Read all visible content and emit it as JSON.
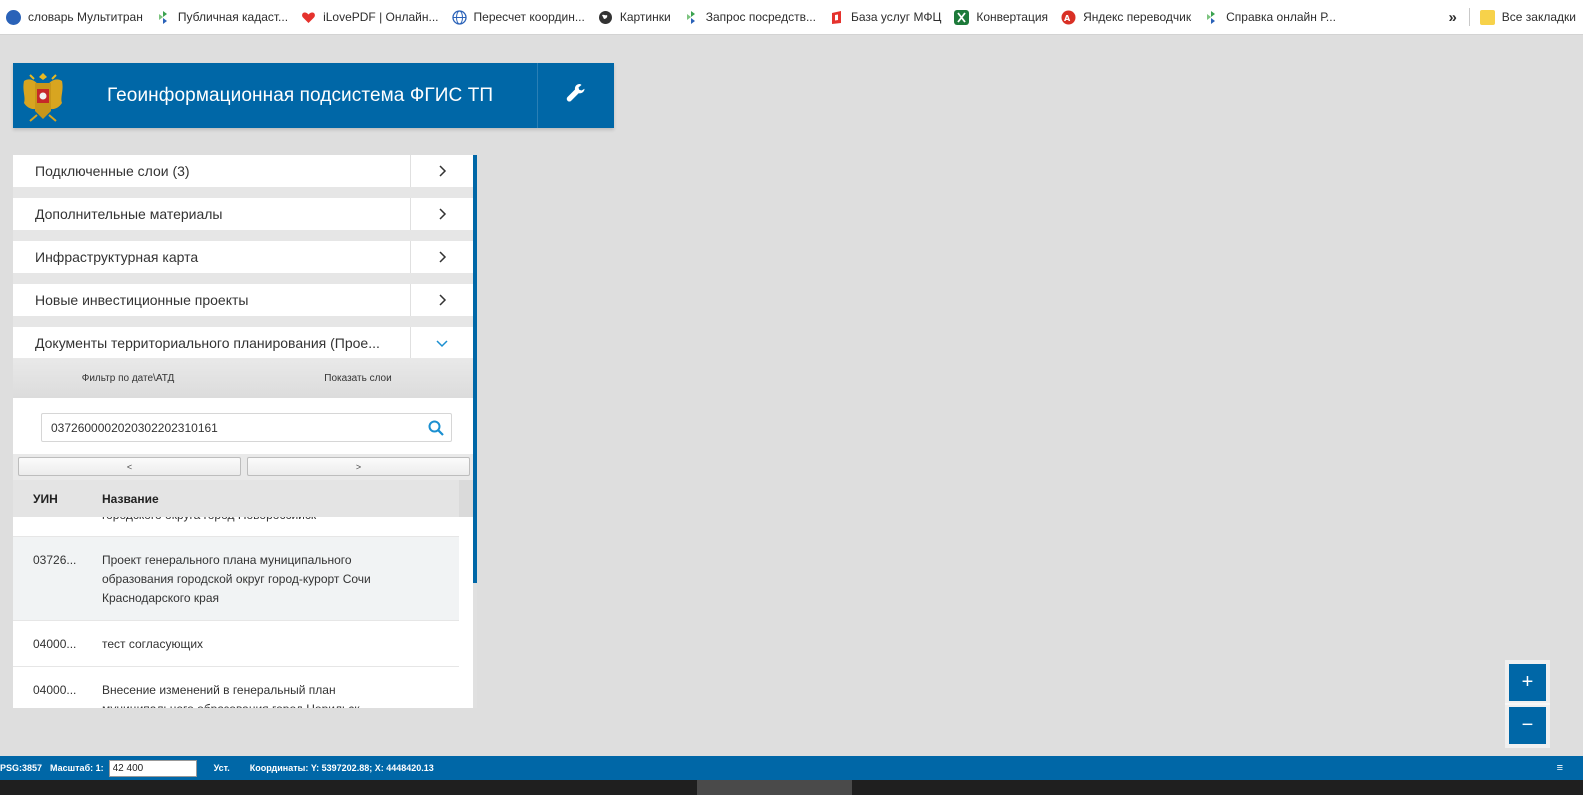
{
  "bookmarks": {
    "items": [
      {
        "label": "словарь Мультитран",
        "icon": "multitran-icon",
        "color": "#2a62b8"
      },
      {
        "label": "Публичная кадаст...",
        "icon": "rosreestr-icon",
        "color": "#3aa24f"
      },
      {
        "label": "iLovePDF | Онлайн...",
        "icon": "heart-icon",
        "color": "#e5322d"
      },
      {
        "label": "Пересчет координ...",
        "icon": "globe-icon",
        "color": "#2a62b8"
      },
      {
        "label": "Картинки",
        "icon": "globe-dark-icon",
        "color": "#333333"
      },
      {
        "label": "Запрос посредств...",
        "icon": "rosreestr-icon",
        "color": "#3aa24f"
      },
      {
        "label": "База услуг МФЦ",
        "icon": "mfc-icon",
        "color": "#e5322d"
      },
      {
        "label": "Конвертация",
        "icon": "excel-icon",
        "color": "#1d7a3a"
      },
      {
        "label": "Яндекс переводчик",
        "icon": "yandex-translate-icon",
        "color": "#d93025"
      },
      {
        "label": "Справка онлайн Р...",
        "icon": "rosreestr-icon",
        "color": "#3aa24f"
      }
    ],
    "more": "»",
    "all_label": "Все закладки"
  },
  "header": {
    "title": "Геоинформационная подсистема ФГИС ТП",
    "accent": "#0067a7"
  },
  "panel": {
    "sections": [
      {
        "label": "Подключенные слои (3)",
        "state": "collapsed"
      },
      {
        "label": "Дополнительные материалы",
        "state": "collapsed"
      },
      {
        "label": "Инфраструктурная карта",
        "state": "collapsed"
      },
      {
        "label": "Новые инвестиционные проекты",
        "state": "collapsed"
      },
      {
        "label": "Документы территориального планирования (Прое...",
        "state": "expanded"
      }
    ],
    "subtabs": {
      "filter": "Фильтр по дате\\АТД",
      "show_layers": "Показать слои"
    },
    "search": {
      "value": "037260000202030220231016​1",
      "placeholder": ""
    },
    "pager": {
      "prev": "<",
      "next": ">"
    },
    "table": {
      "columns": {
        "uin": "УИН",
        "name": "Название"
      },
      "partial_top": "городского округа город Новороссийск",
      "rows": [
        {
          "uin": "03726...",
          "name": "Проект генерального плана муниципального образования городской округ город-курорт Сочи Краснодарского края"
        },
        {
          "uin": "04000...",
          "name": "тест согласующих"
        },
        {
          "uin": "04000...",
          "name": "Внесение изменений в генеральный план муниципального образования город Норильск"
        }
      ]
    }
  },
  "zoom": {
    "in": "+",
    "out": "−"
  },
  "statusbar": {
    "epsg": "PSG:3857",
    "scale_label": "Масштаб: 1:",
    "scale_value": "42 400",
    "set_label": "Уст.",
    "coords": "Координаты: Y: 5397202.88; X: 4448420.13",
    "menu": "≡"
  }
}
